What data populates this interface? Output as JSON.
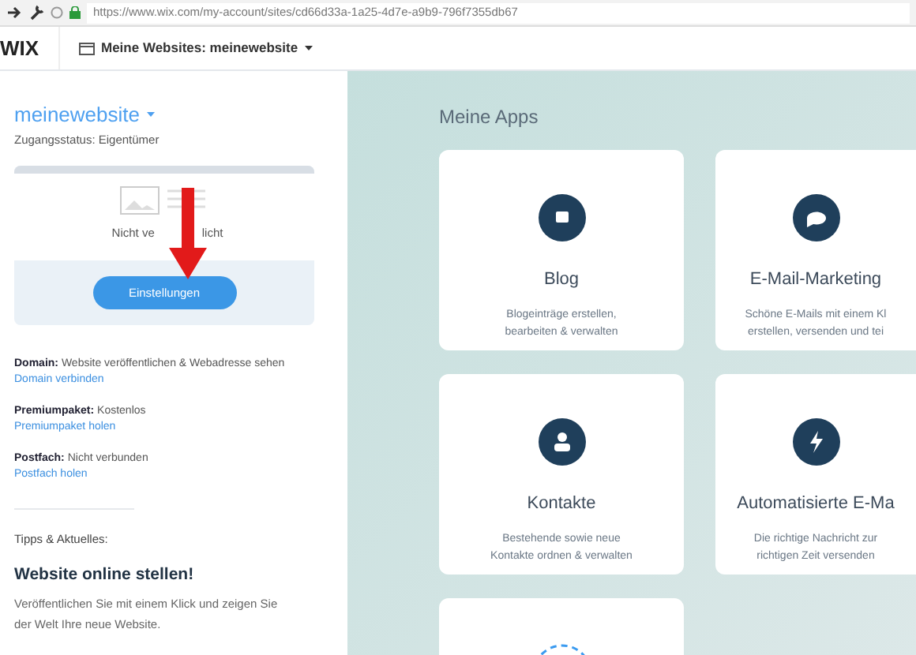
{
  "browser": {
    "url": "https://www.wix.com/my-account/sites/cd66d33a-1a25-4d7e-a9b9-796f7355db67"
  },
  "header": {
    "logo": "WIX",
    "site_selector": "Meine Websites: meinewebsite"
  },
  "sidebar": {
    "site_name": "meinewebsite",
    "access_status": "Zugangsstatus: Eigentümer",
    "preview": {
      "status_parts": [
        "Nicht ve",
        "licht"
      ],
      "button": "Einstellungen"
    },
    "details": [
      {
        "label": "Domain:",
        "value": "Website veröffentlichen & Webadresse sehen",
        "link": "Domain verbinden"
      },
      {
        "label": "Premiumpaket:",
        "value": "Kostenlos",
        "link": "Premiumpaket holen"
      },
      {
        "label": "Postfach:",
        "value": "Nicht verbunden",
        "link": "Postfach holen"
      }
    ],
    "tips_heading": "Tipps & Aktuelles:",
    "tip_title": "Website online stellen!",
    "tip_text": "Veröffentlichen Sie mit einem Klick und zeigen Sie der Welt Ihre neue Website."
  },
  "main": {
    "title": "Meine Apps",
    "apps": [
      {
        "kind": "blog",
        "name": "Blog",
        "description": "Blogeinträge erstellen, bearbeiten & verwalten"
      },
      {
        "kind": "email",
        "name": "E-Mail-Marketing",
        "description": "Schöne E-Mails mit einem Kl erstellen, versenden und tei"
      },
      {
        "kind": "contacts",
        "name": "Kontakte",
        "description": "Bestehende sowie neue Kontakte ordnen & verwalten"
      },
      {
        "kind": "automation",
        "name": "Automatisierte E-Ma",
        "description": "Die richtige Nachricht zur richtigen Zeit versenden"
      },
      {
        "kind": "add"
      }
    ]
  }
}
